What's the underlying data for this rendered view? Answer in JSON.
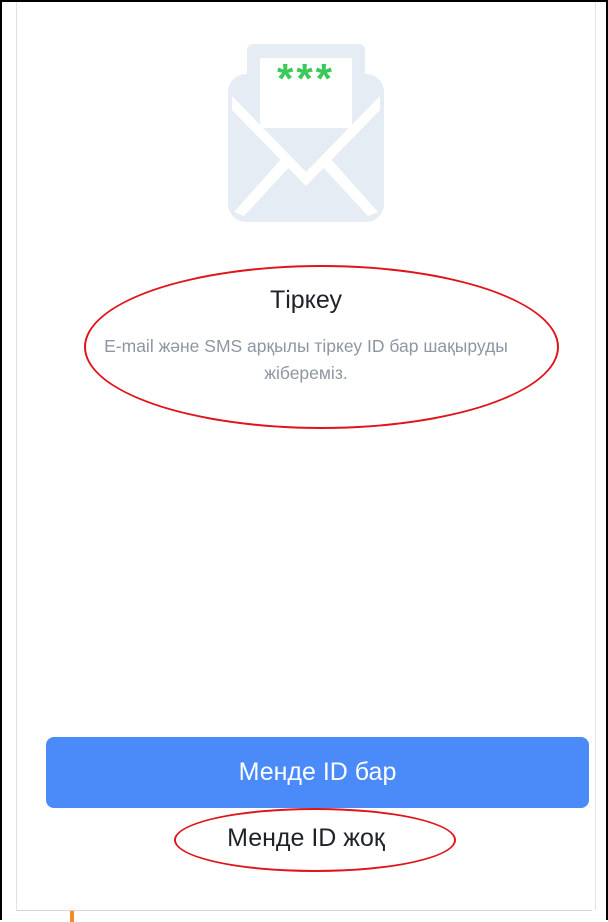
{
  "screen": {
    "title": "Тіркеу",
    "description": "E-mail және SMS арқылы тіркеу ID бар шақыруды жібереміз.",
    "illustration": {
      "icon": "mail-with-password-icon",
      "password_mask": "***",
      "envelope_color": "#e6ecf4",
      "mask_color": "#3cc95a"
    }
  },
  "actions": {
    "have_id_label": "Менде ID бар",
    "no_id_label": "Менде ID жоқ",
    "primary_color": "#4a8af9"
  },
  "annotations": {
    "color": "#e0141b"
  }
}
